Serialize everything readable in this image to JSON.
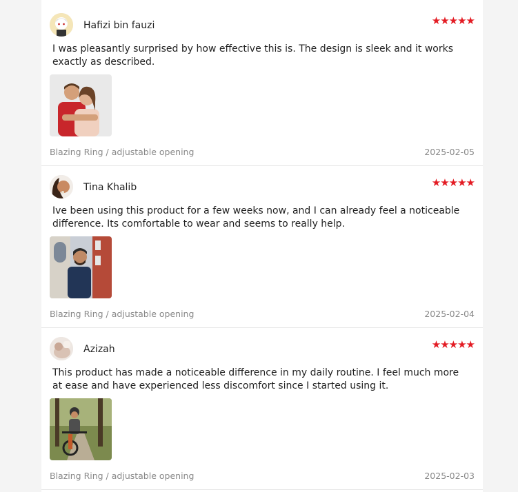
{
  "reviews": [
    {
      "author": "Hafizi bin fauzi",
      "rating_stars": "★★★★★",
      "rating": 5,
      "text": "I was pleasantly surprised by how effective this is. The design is sleek and it works exactly as described.",
      "variant": "Blazing Ring / adjustable opening",
      "date": "2025-02-05"
    },
    {
      "author": "Tina Khalib",
      "rating_stars": "★★★★★",
      "rating": 5,
      "text": "Ive been using this product for a few weeks now, and I can already feel a noticeable difference. Its comfortable to wear and seems to really help.",
      "variant": "Blazing Ring / adjustable opening",
      "date": "2025-02-04"
    },
    {
      "author": "Azizah",
      "rating_stars": "★★★★★",
      "rating": 5,
      "text": "This product has made a noticeable difference in my daily routine. I feel much more at ease and have experienced less discomfort since I started using it.",
      "variant": "Blazing Ring / adjustable opening",
      "date": "2025-02-03"
    }
  ],
  "colors": {
    "star": "#e31b23",
    "meta": "#888888",
    "divider": "#e8e8e8",
    "page_bg": "#f4f4f4"
  }
}
